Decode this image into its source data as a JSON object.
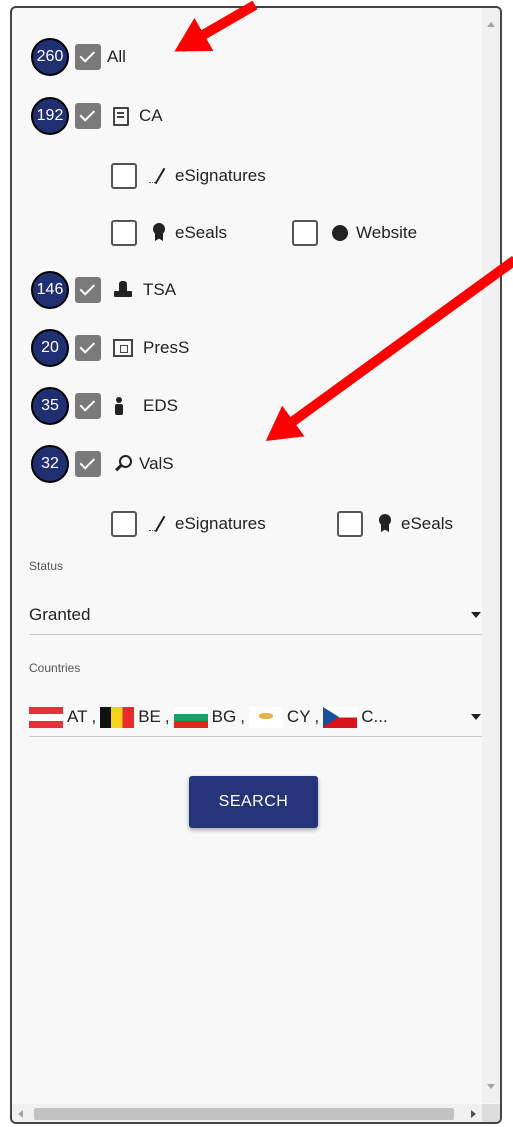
{
  "filters": {
    "all": {
      "count": "260",
      "label": "All",
      "checked": true
    },
    "ca": {
      "count": "192",
      "label": "CA",
      "checked": true,
      "sub": {
        "esignatures": "eSignatures",
        "eseals": "eSeals",
        "website": "Website"
      }
    },
    "tsa": {
      "count": "146",
      "label": "TSA",
      "checked": true
    },
    "press": {
      "count": "20",
      "label": "PresS",
      "checked": true
    },
    "eds": {
      "count": "35",
      "label": "EDS",
      "checked": true
    },
    "vals": {
      "count": "32",
      "label": "ValS",
      "checked": true,
      "sub": {
        "esignatures": "eSignatures",
        "eseals": "eSeals"
      }
    }
  },
  "status": {
    "label": "Status",
    "value": "Granted"
  },
  "countries": {
    "label": "Countries",
    "items": [
      {
        "code": "AT",
        "sep": ","
      },
      {
        "code": "BE",
        "sep": ","
      },
      {
        "code": "BG",
        "sep": ","
      },
      {
        "code": "CY",
        "sep": ","
      },
      {
        "code": "C...",
        "sep": ""
      }
    ]
  },
  "search_button": "SEARCH",
  "icons": [
    "doc-icon",
    "signature-icon",
    "seal-icon",
    "globe-icon",
    "stamp-icon",
    "presentation-icon",
    "person-icon",
    "magnifier-icon"
  ],
  "colors": {
    "badge": "#1f2f72",
    "button": "#263479",
    "annotation_arrow": "#ff0000"
  }
}
